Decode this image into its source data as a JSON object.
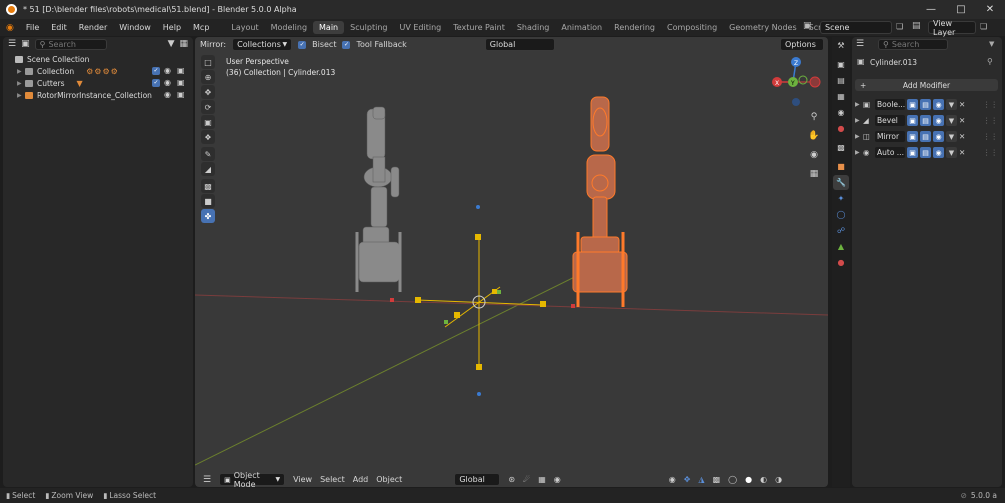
{
  "window": {
    "title": "* 51 [D:\\blender files\\robots\\medical\\51.blend] - Blender 5.0.0 Alpha",
    "minimize_icon": "minimize-icon",
    "maximize_icon": "maximize-icon",
    "close_icon": "close-icon"
  },
  "menu": {
    "items": [
      "File",
      "Edit",
      "Render",
      "Window",
      "Help",
      "Mcp"
    ],
    "workspaces": [
      "Layout",
      "Modeling",
      "Main",
      "Sculpting",
      "UV Editing",
      "Texture Paint",
      "Shading",
      "Animation",
      "Rendering",
      "Compositing",
      "Geometry Nodes",
      "Scripting"
    ],
    "active_workspace": "Main",
    "add_tab": "+",
    "scene": "Scene",
    "view_layer": "View Layer"
  },
  "outliner": {
    "search_placeholder": "Search",
    "root": "Scene Collection",
    "items": [
      {
        "label": "Collection"
      },
      {
        "label": "Cutters"
      },
      {
        "label": "RotorMirrorInstance_Collection"
      }
    ]
  },
  "viewport": {
    "mirror_label": "Mirror:",
    "collections_dropdown": "Collections",
    "bisect_label": "Bisect",
    "tool_fallback_label": "Tool Fallback",
    "transform_orientation": "Global",
    "options_label": "Options",
    "perspective_label": "User Perspective",
    "object_info": "(36) Collection | Cylinder.013",
    "mode": "Object Mode",
    "footer_menus": [
      "View",
      "Select",
      "Add",
      "Object"
    ],
    "footer_orientation": "Global",
    "gizmo_axes": {
      "x": "X",
      "y": "Y",
      "z": "Z"
    }
  },
  "properties": {
    "search_placeholder": "Search",
    "object_name": "Cylinder.013",
    "add_modifier": "Add Modifier",
    "modifiers": [
      {
        "name": "Boole..."
      },
      {
        "name": "Bevel"
      },
      {
        "name": "Mirror"
      },
      {
        "name": "Auto ..."
      }
    ]
  },
  "statusbar": {
    "select": "Select",
    "zoom_view": "Zoom View",
    "lasso_select": "Lasso Select",
    "version": "5.0.0 a"
  },
  "colors": {
    "accent": "#4772b3",
    "selection": "#e8702a",
    "bg": "#393939"
  }
}
